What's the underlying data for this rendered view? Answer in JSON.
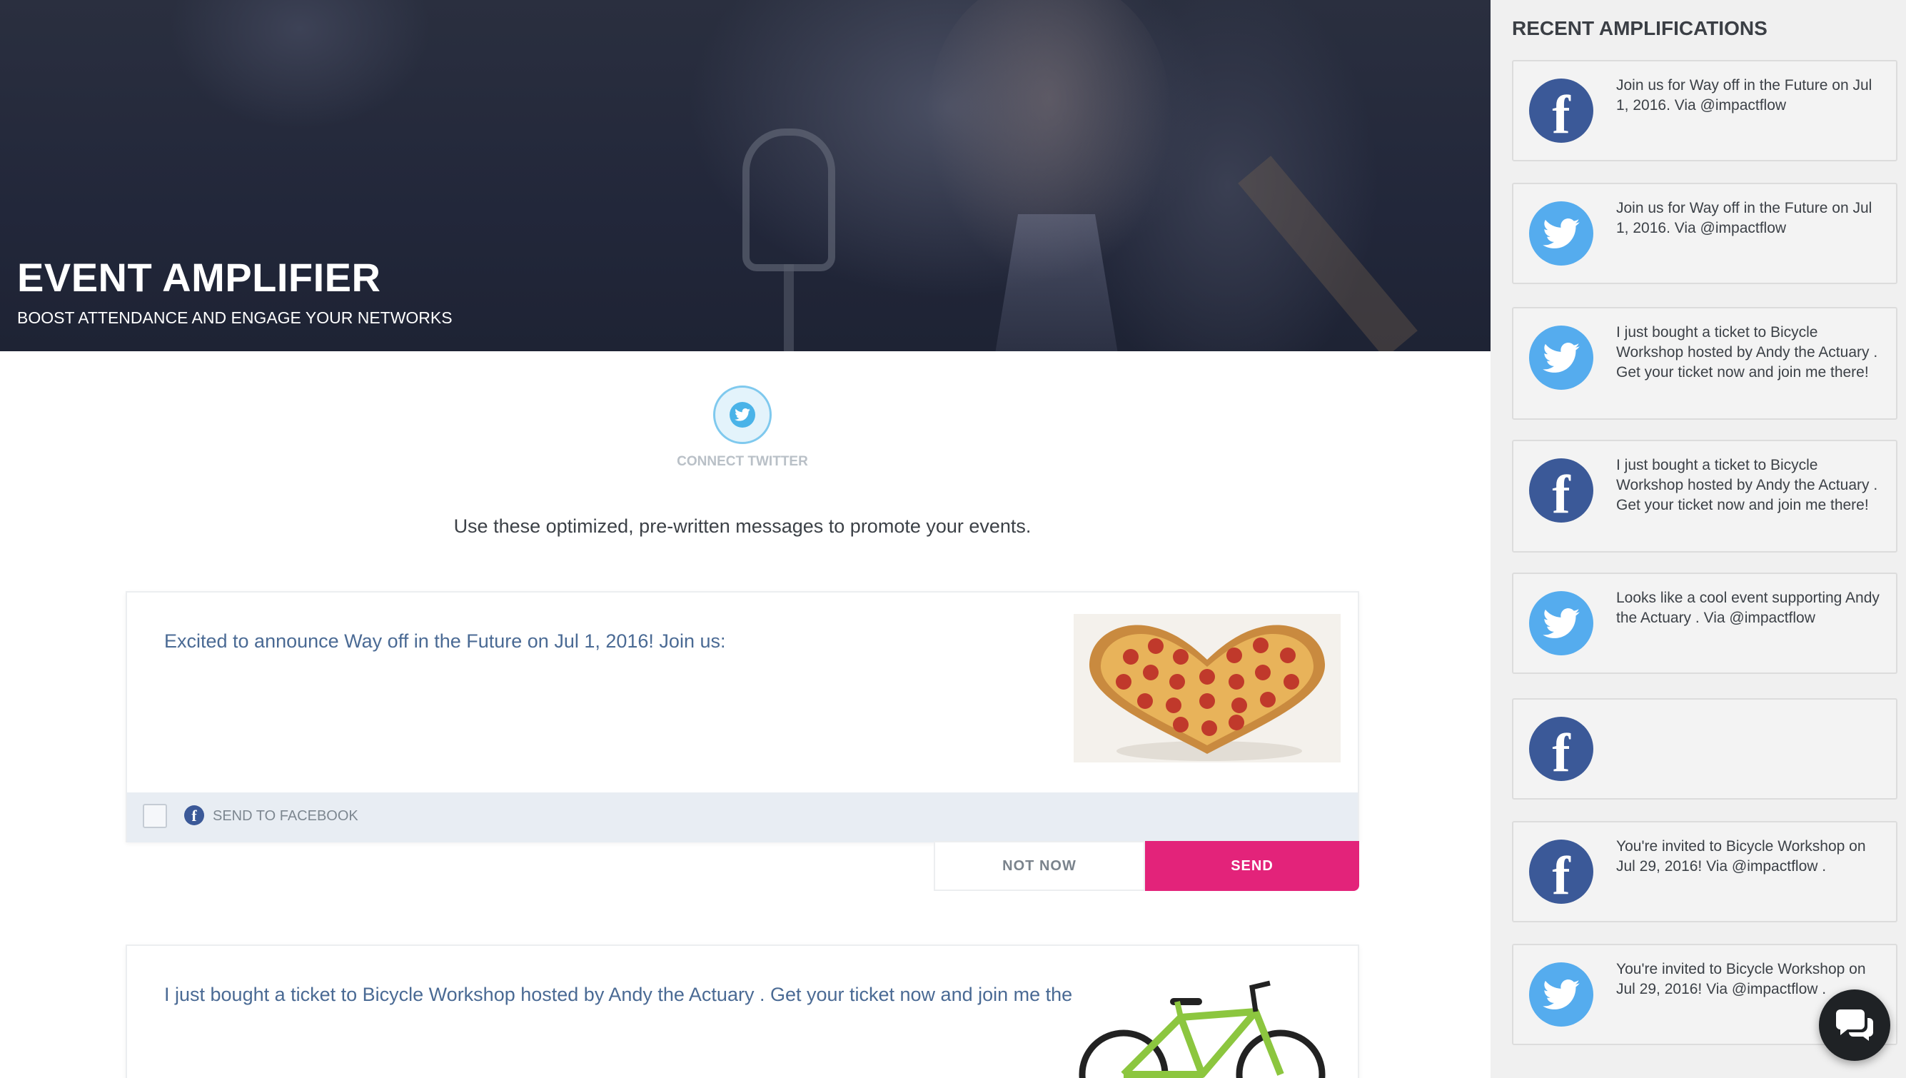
{
  "hero": {
    "title": "EVENT AMPLIFIER",
    "subtitle": "BOOST ATTENDANCE AND ENGAGE YOUR NETWORKS"
  },
  "connect": {
    "label": "CONNECT TWITTER",
    "icon": "twitter-icon",
    "color": "#4ab3e8"
  },
  "intro": "Use these optimized, pre-written messages to promote your events.",
  "messages": [
    {
      "text": "Excited to announce Way off in the Future on Jul 1, 2016! Join us:",
      "image": "heart-pizza-image",
      "send_label": "SEND TO FACEBOOK",
      "network": "facebook"
    },
    {
      "text": "I just bought a ticket to Bicycle Workshop hosted by Andy the Actuary . Get your ticket now and join me there!",
      "image": "bicycle-image"
    }
  ],
  "actions": {
    "not_now": "NOT NOW",
    "send": "SEND",
    "send_color": "#e3237a"
  },
  "sidebar": {
    "title": "RECENT AMPLIFICATIONS",
    "items": [
      {
        "network": "facebook",
        "text": "Join us for Way off in the Future on Jul 1, 2016. Via @impactflow"
      },
      {
        "network": "twitter",
        "text": "Join us for Way off in the Future on Jul 1, 2016. Via @impactflow"
      },
      {
        "network": "twitter",
        "text": "I just bought a ticket to Bicycle Workshop hosted by Andy the Actuary . Get your ticket now and join me there!"
      },
      {
        "network": "facebook",
        "text": "I just bought a ticket to Bicycle Workshop hosted by Andy the Actuary . Get your ticket now and join me there!"
      },
      {
        "network": "twitter",
        "text": "Looks like a cool event supporting Andy the Actuary . Via @impactflow"
      },
      {
        "network": "facebook",
        "text": ""
      },
      {
        "network": "facebook",
        "text": "You're invited to Bicycle Workshop on Jul 29, 2016! Via @impactflow ."
      },
      {
        "network": "twitter",
        "text": "You're invited to Bicycle Workshop on Jul 29, 2016! Via @impactflow ."
      }
    ]
  },
  "colors": {
    "facebook": "#3b5998",
    "twitter": "#55acee",
    "message_text": "#4a6a94"
  }
}
